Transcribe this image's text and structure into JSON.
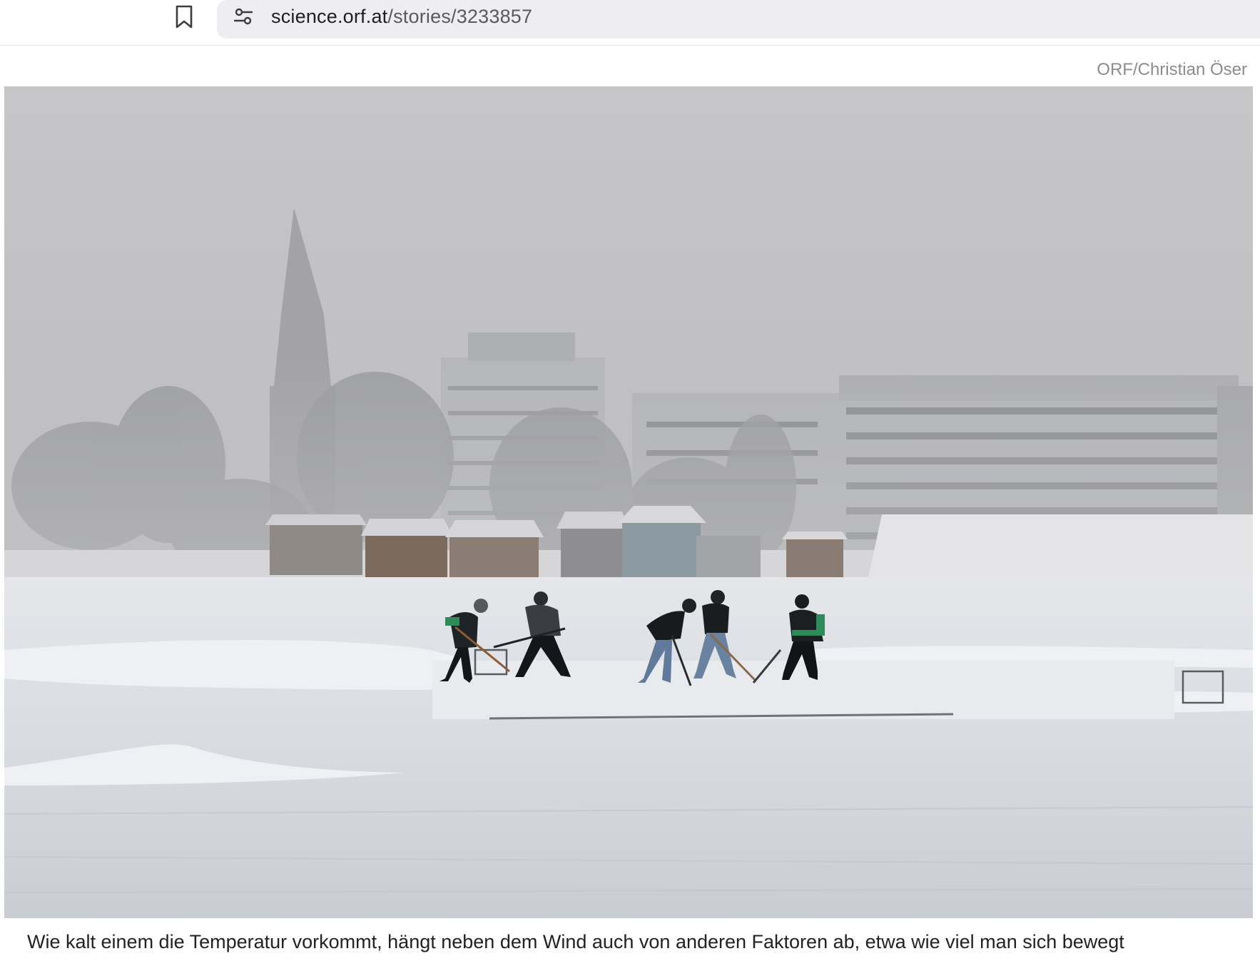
{
  "browser": {
    "url_host": "science.orf.at",
    "url_path": "/stories/3233857",
    "icons": {
      "bookmark": "bookmark-icon",
      "site_settings": "tune-icon"
    }
  },
  "article": {
    "photo_credit": "ORF/Christian Öser",
    "caption": "Wie kalt einem die Temperatur vorkommt, hängt neben dem Wind auch von anderen Faktoren ab, etwa wie viel man sich bewegt"
  },
  "colors": {
    "address_bar_bg": "#eeeef2",
    "credit_text": "#8c8c8c",
    "caption_text": "#222222"
  }
}
